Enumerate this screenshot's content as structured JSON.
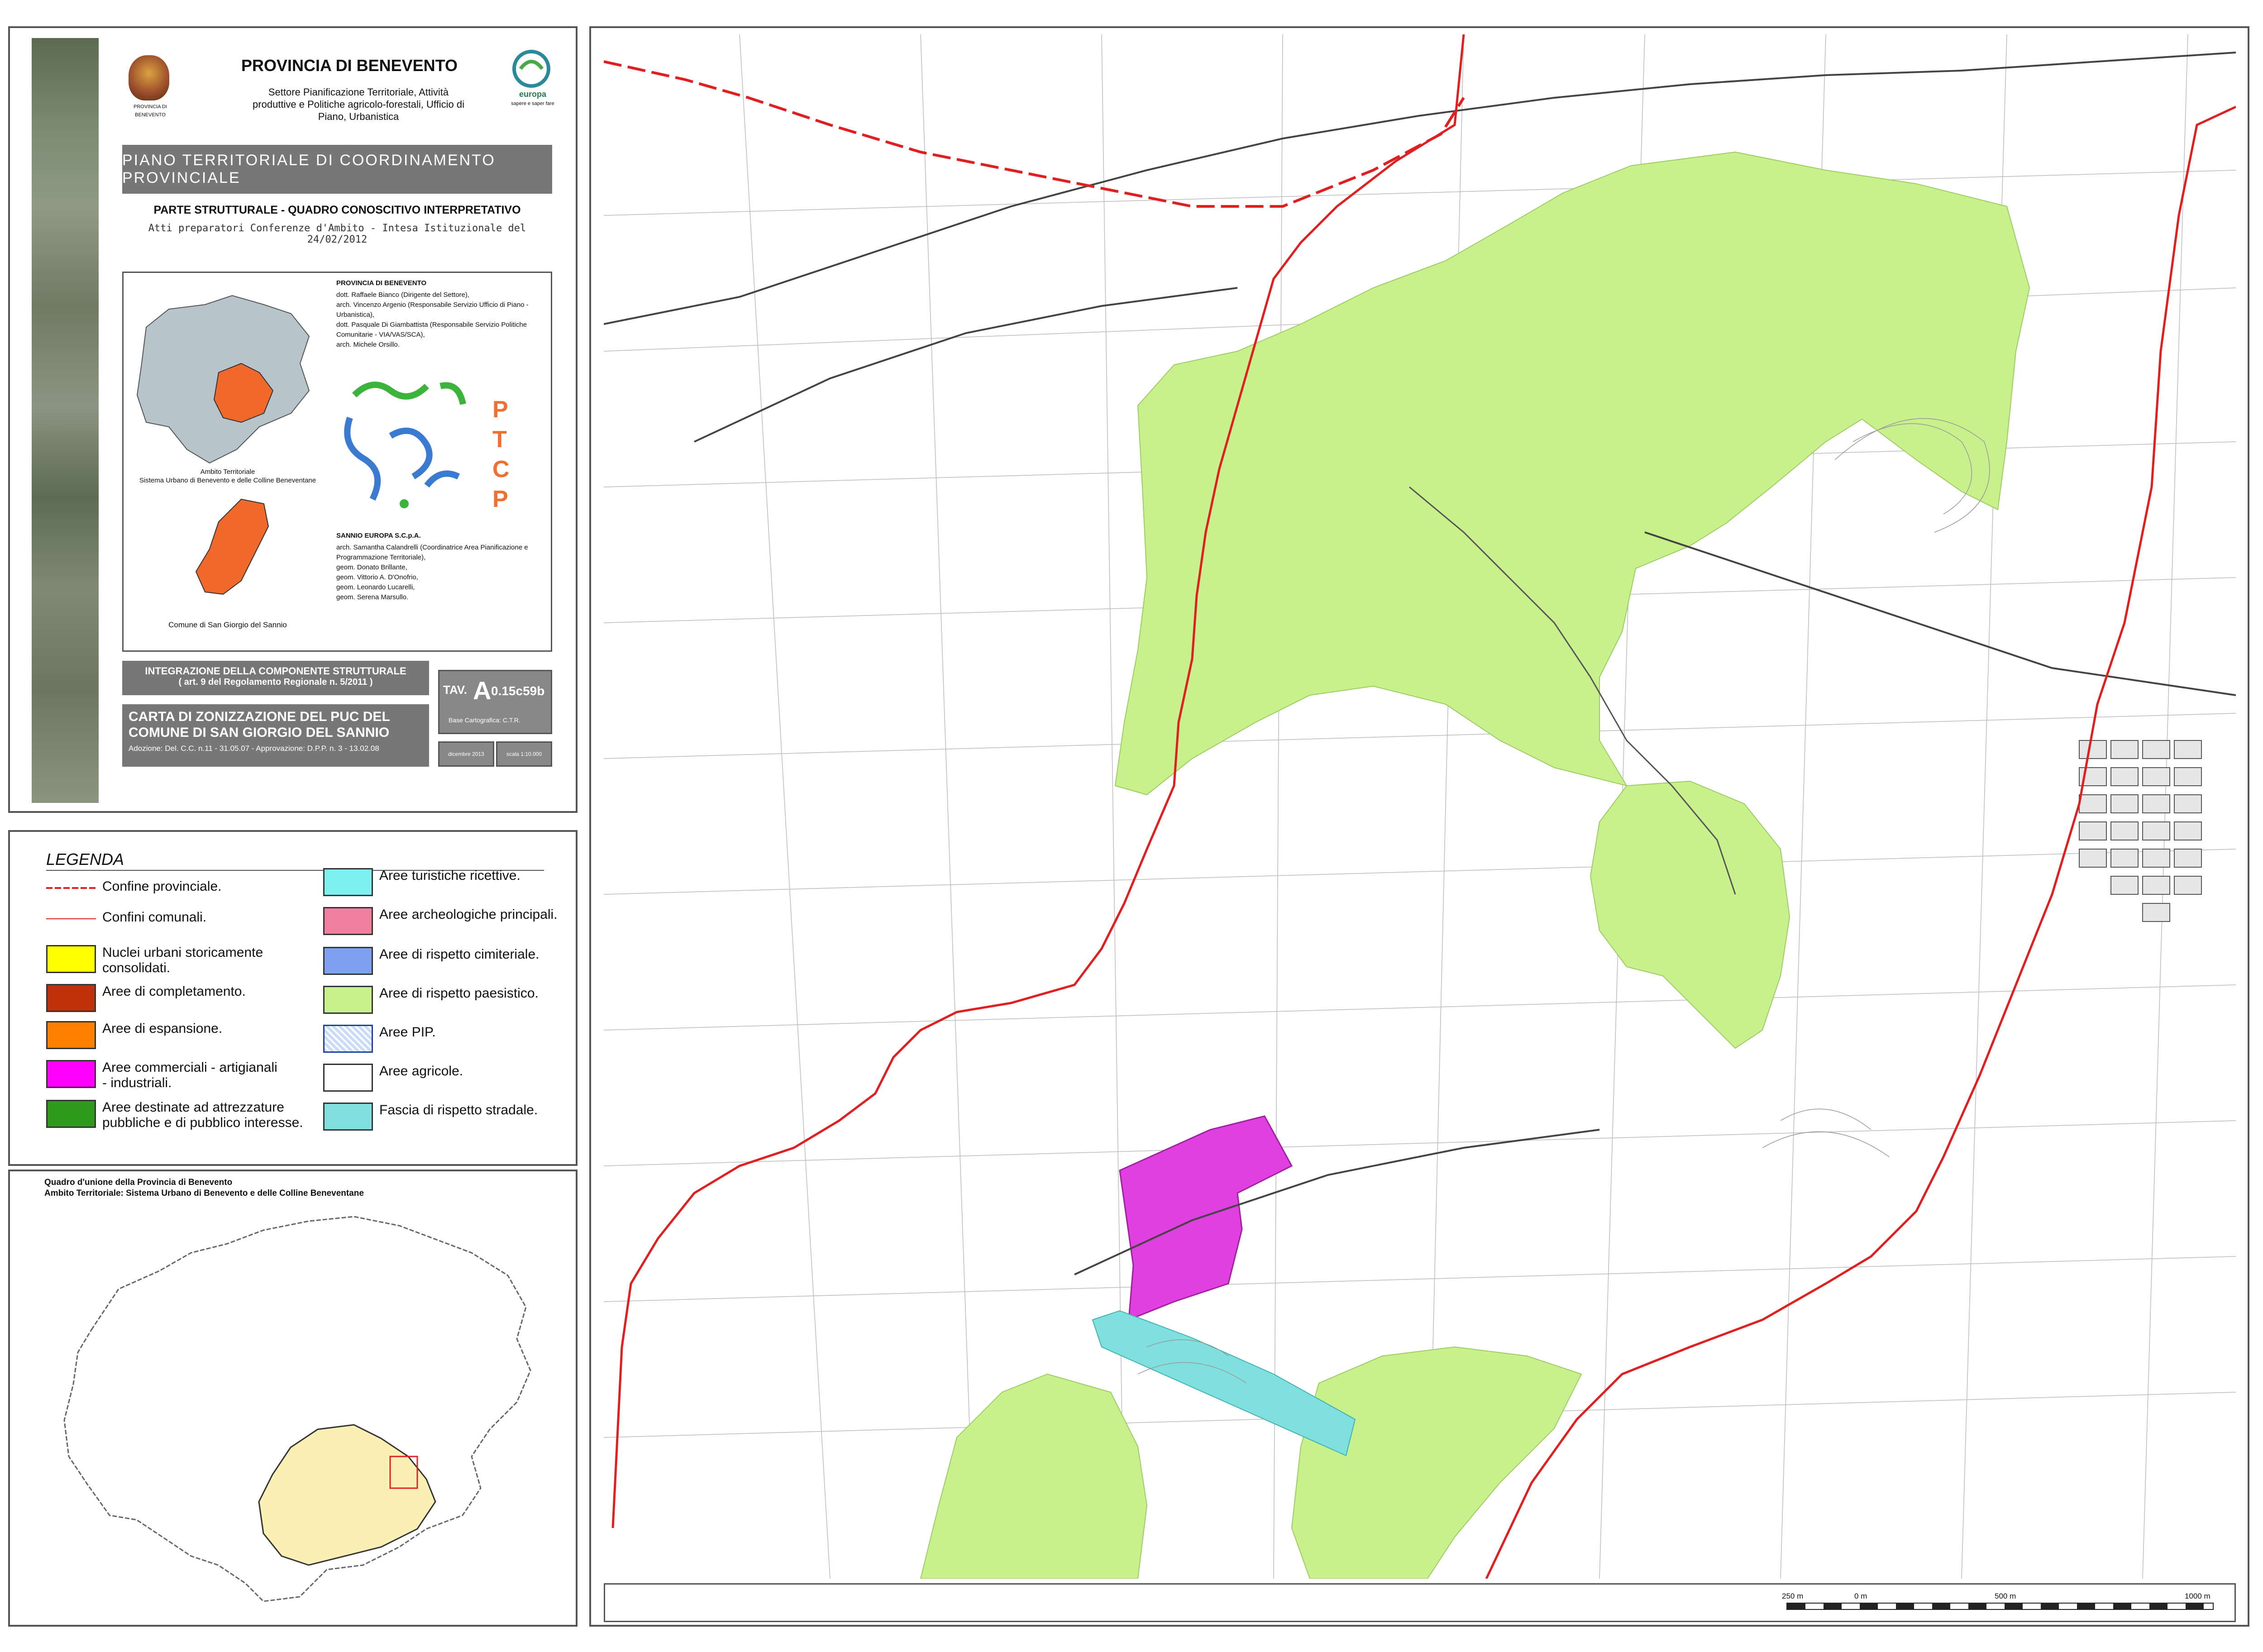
{
  "header": {
    "province": "PROVINCIA DI BENEVENTO",
    "logo_caption": "PROVINCIA DI BENEVENTO",
    "office": "Settore Pianificazione Territoriale, Attività produttive e Politiche agricolo-forestali, Ufficio di Piano, Urbanistica",
    "partner_logo_text": "europa",
    "partner_logo_sub": "sapere e saper fare",
    "plan_title": "PIANO TERRITORIALE DI COORDINAMENTO PROVINCIALE",
    "section_title": "PARTE STRUTTURALE - QUADRO CONOSCITIVO INTERPRETATIVO",
    "subtitle": "Atti preparatori Conferenze d'Ambito - Intesa Istituzionale del 24/02/2012"
  },
  "credits": {
    "org1": "PROVINCIA DI BENEVENTO",
    "org1_people": "dott. Raffaele Bianco (Dirigente del Settore),\narch. Vincenzo Argenio (Responsabile Servizio Ufficio di Piano - Urbanistica),\ndott. Pasquale Di Giambattista (Responsabile Servizio Politiche Comunitarie - VIA/VAS/SCA),\narch. Michele Orsillo.",
    "org2": "SANNIO EUROPA S.C.p.A.",
    "org2_people": "arch. Samantha Calandrelli (Coordinatrice Area Pianificazione e Programmazione Territoriale),\ngeom. Donato Brillante,\ngeom. Vittorio A. D'Onofrio,\ngeom. Leonardo Lucarelli,\ngeom. Serena Marsullo.",
    "ptcp_letters": [
      "P",
      "T",
      "C",
      "P"
    ],
    "ambito_caption": "Ambito Territoriale\nSistema Urbano di Benevento e delle Colline Beneventane",
    "comune_caption": "Comune di San Giorgio del Sannio"
  },
  "tavola": {
    "integration_line1": "INTEGRAZIONE DELLA COMPONENTE STRUTTURALE",
    "integration_line2": "( art. 9 del Regolamento Regionale n. 5/2011 )",
    "map_title": "CARTA DI ZONIZZAZIONE DEL PUC DEL COMUNE DI SAN GIORGIO DEL SANNIO",
    "adoption": "Adozione: Del. C.C. n.11 - 31.05.07 - Approvazione: D.P.P. n. 3 - 13.02.08",
    "tav_prefix": "TAV.",
    "tav_big": "A",
    "tav_code": "0.15c59b",
    "base": "Base Cartografica: C.T.R.",
    "date": "dicembre 2013",
    "scale": "scala 1:10.000"
  },
  "legend": {
    "title": "LEGENDA",
    "left": [
      {
        "label": "Confine provinciale.",
        "type": "line-prov"
      },
      {
        "label": "Confini comunali.",
        "type": "line-com"
      },
      {
        "label": "Nuclei urbani storicamente consolidati.",
        "color": "#ffff00"
      },
      {
        "label": "Aree di completamento.",
        "color": "#c0300a"
      },
      {
        "label": "Aree di espansione.",
        "color": "#ff8000"
      },
      {
        "label": "Aree commerciali - artigianali - industriali.",
        "color": "#ff00ff"
      },
      {
        "label": "Aree destinate ad attrezzature pubbliche e di pubblico interesse.",
        "color": "#2f9a1a"
      }
    ],
    "right": [
      {
        "label": "Aree turistiche ricettive.",
        "color": "#7ff0f0"
      },
      {
        "label": "Aree archeologiche principali.",
        "color": "#f07fa0"
      },
      {
        "label": "Aree di rispetto cimiteriale.",
        "color": "#7fa0f0"
      },
      {
        "label": "Aree di rispetto paesistico.",
        "color": "#c8f08c"
      },
      {
        "label": "Aree PIP.",
        "color": "#c8dcf8"
      },
      {
        "label": "Aree agricole.",
        "color": "#ffffff"
      },
      {
        "label": "Fascia di rispetto stradale.",
        "color": "#80e0e0"
      }
    ]
  },
  "quadro": {
    "title": "Quadro d'unione della Provincia di Benevento",
    "subtitle": "Ambito Territoriale: Sistema Urbano di Benevento e delle Colline Beneventane"
  },
  "scalebar": {
    "labels": [
      "250 m",
      "0 m",
      "500 m",
      "1000 m"
    ]
  },
  "colors": {
    "provincial_border": "#e02020",
    "paesistico": "#c8f08c",
    "industrial": "#e040e0",
    "road_buffer": "#80e0e0"
  }
}
